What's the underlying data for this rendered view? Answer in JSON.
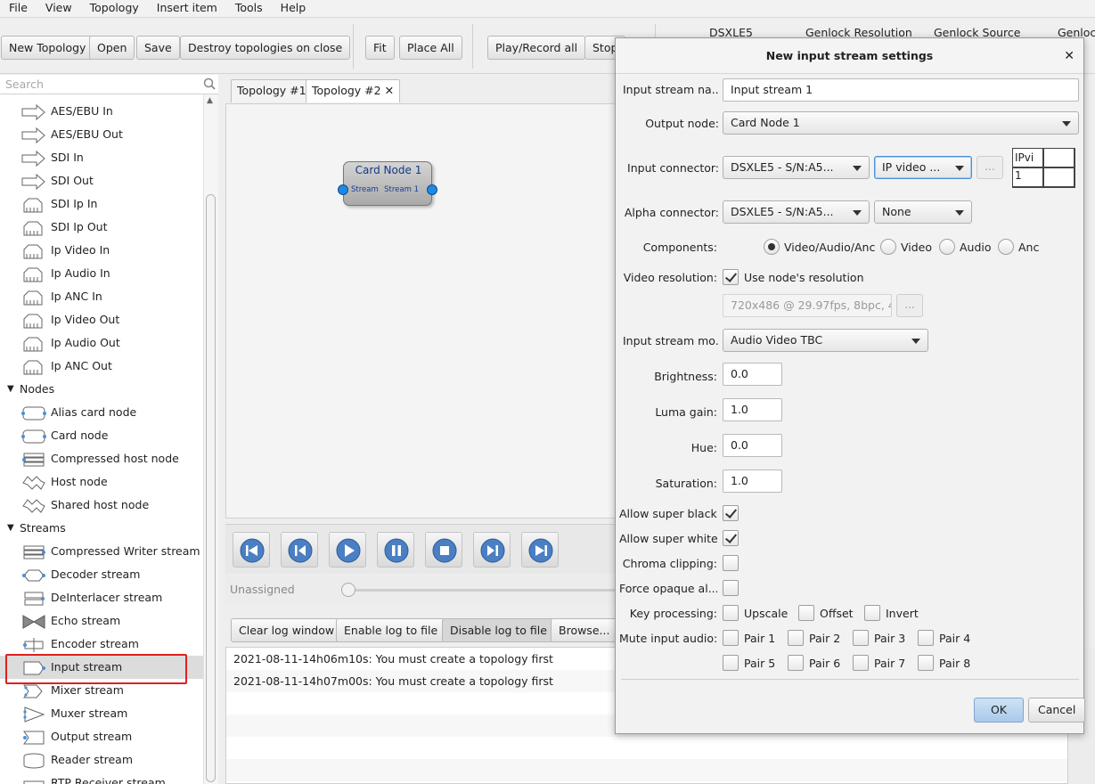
{
  "menu": [
    "File",
    "View",
    "Topology",
    "Insert item",
    "Tools",
    "Help"
  ],
  "toolbar": {
    "new_topology": "New Topology",
    "open": "Open",
    "save": "Save",
    "destroy": "Destroy topologies on close",
    "fit": "Fit",
    "place_all": "Place All",
    "play_record_all": "Play/Record all",
    "stop": "Stop",
    "columns": [
      "DSXLE5",
      "Genlock Resolution",
      "Genlock Source",
      "Genlock"
    ]
  },
  "sidebar": {
    "search_placeholder": "Search",
    "connectors": [
      "AES/EBU In",
      "AES/EBU Out",
      "SDI In",
      "SDI Out",
      "SDI Ip In",
      "SDI Ip Out",
      "Ip Video In",
      "Ip Audio In",
      "Ip ANC In",
      "Ip Video Out",
      "Ip Audio Out",
      "Ip ANC Out"
    ],
    "nodes_label": "Nodes",
    "nodes": [
      "Alias card node",
      "Card node",
      "Compressed host node",
      "Host node",
      "Shared host node"
    ],
    "streams_label": "Streams",
    "streams": [
      "Compressed Writer stream",
      "Decoder stream",
      "DeInterlacer stream",
      "Echo stream",
      "Encoder stream",
      "Input stream",
      "Mixer stream",
      "Muxer stream",
      "Output stream",
      "Reader stream",
      "RTP Receiver stream"
    ],
    "selected": "Input stream"
  },
  "tabs": [
    "Topology #1",
    "Topology #2"
  ],
  "node": {
    "title": "Card Node 1",
    "port_left": "Stream",
    "port_right": "Stream 1"
  },
  "player": {
    "status": "Unassigned"
  },
  "log": {
    "clear": "Clear log window",
    "enable": "Enable log to file",
    "disable": "Disable log to file",
    "browse": "Browse...",
    "lines": [
      "2021-08-11-14h06m10s: You must create a topology first",
      "2021-08-11-14h07m00s: You must create a topology first"
    ]
  },
  "dialog": {
    "title": "New input stream settings",
    "name_label": "Input stream na...",
    "name_value": "Input stream 1",
    "output_node_label": "Output node:",
    "output_node_value": "Card Node 1",
    "input_connector_label": "Input connector:",
    "input_connector_card": "DSXLE5 - S/N:A5...",
    "input_connector_type": "IP video ...",
    "grid_cell": "IPvi 1",
    "alpha_connector_label": "Alpha connector:",
    "alpha_connector_card": "DSXLE5 - S/N:A5...",
    "alpha_connector_type": "None",
    "components_label": "Components:",
    "components": [
      "Video/Audio/Anc",
      "Video",
      "Audio",
      "Anc"
    ],
    "video_resolution_label": "Video resolution:",
    "use_node_resolution": "Use node's resolution",
    "resolution_value": "720x486 @ 29.97fps, 8bpc, 4",
    "mode_label": "Input stream mo...",
    "mode_value": "Audio Video TBC",
    "brightness_label": "Brightness:",
    "brightness": "0.0",
    "luma_gain_label": "Luma gain:",
    "luma_gain": "1.0",
    "hue_label": "Hue:",
    "hue": "0.0",
    "saturation_label": "Saturation:",
    "saturation": "1.0",
    "super_black_label": "Allow super black:",
    "super_white_label": "Allow super white:",
    "chroma_clipping_label": "Chroma clipping:",
    "force_opaque_label": "Force opaque al...",
    "key_processing_label": "Key processing:",
    "key_options": [
      "Upscale",
      "Offset",
      "Invert"
    ],
    "mute_label": "Mute input audio:",
    "pairs": [
      "Pair 1",
      "Pair 2",
      "Pair 3",
      "Pair 4",
      "Pair 5",
      "Pair 6",
      "Pair 7",
      "Pair 8"
    ],
    "ok": "OK",
    "cancel": "Cancel",
    "dots": "..."
  }
}
